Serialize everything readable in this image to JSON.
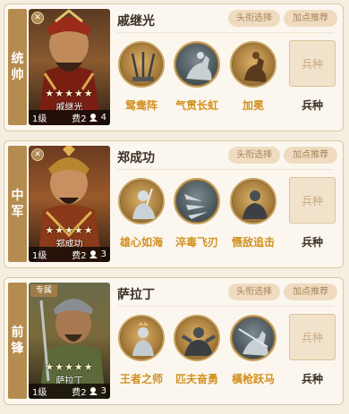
{
  "colors": {
    "accent": "#d2901f",
    "side": "#b58c4f",
    "pill_bg": "#efdcc0"
  },
  "cards": [
    {
      "role": "统帅",
      "role_chars": [
        "统",
        "帅"
      ],
      "badge": "✕",
      "badge_type": "x",
      "name": "戚继光",
      "portrait_name": "戚继光",
      "stars": "★★★★★",
      "level": "1级",
      "cost": "费2",
      "count": "4",
      "btn_title": "头衔选择",
      "btn_points": "加点推荐",
      "skills": [
        {
          "label": "鸳鸯阵",
          "icon": "swords-icon",
          "style": "gold"
        },
        {
          "label": "气贯长虹",
          "icon": "horseman-icon",
          "style": "grey"
        },
        {
          "label": "加冕",
          "icon": "rider-icon",
          "style": "gold"
        }
      ],
      "troop_slot": "兵种",
      "troop_label": "兵种"
    },
    {
      "role": "中军",
      "role_chars": [
        "中",
        "军"
      ],
      "badge": "✕",
      "badge_type": "x",
      "name": "郑成功",
      "portrait_name": "郑成功",
      "stars": "★★★★★",
      "level": "1级",
      "cost": "费2",
      "count": "3",
      "btn_title": "头衔选择",
      "btn_points": "加点推荐",
      "skills": [
        {
          "label": "雄心如海",
          "icon": "warrior-icon",
          "style": "gold"
        },
        {
          "label": "淬毒飞刃",
          "icon": "blades-icon",
          "style": "grey"
        },
        {
          "label": "慑敌追击",
          "icon": "knight-icon",
          "style": "gold"
        }
      ],
      "troop_slot": "兵种",
      "troop_label": "兵种"
    },
    {
      "role": "前锋",
      "role_chars": [
        "前",
        "锋"
      ],
      "badge": "专属",
      "badge_type": "tag",
      "name": "萨拉丁",
      "portrait_name": "萨拉丁",
      "stars": "★★★★★",
      "level": "1级",
      "cost": "费2",
      "count": "3",
      "btn_title": "头衔选择",
      "btn_points": "加点推荐",
      "skills": [
        {
          "label": "王者之师",
          "icon": "king-icon",
          "style": "gold"
        },
        {
          "label": "匹夫奋勇",
          "icon": "brawler-icon",
          "style": "gold"
        },
        {
          "label": "橫枪跃马",
          "icon": "lancer-icon",
          "style": "grey"
        }
      ],
      "troop_slot": "兵种",
      "troop_label": "兵种"
    }
  ]
}
